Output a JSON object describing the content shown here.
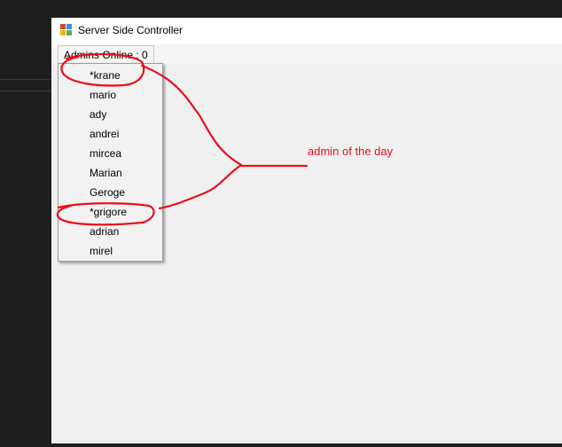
{
  "window": {
    "title": "Server Side Controller",
    "icon": "windows-forms-app-icon"
  },
  "menubar": {
    "admins_menu_label": "Admins Online : 0"
  },
  "dropdown": {
    "items": [
      {
        "label": "*krane"
      },
      {
        "label": "mario"
      },
      {
        "label": "ady"
      },
      {
        "label": "andrei"
      },
      {
        "label": "mircea"
      },
      {
        "label": "Marian"
      },
      {
        "label": "Geroge"
      },
      {
        "label": "*grigore"
      },
      {
        "label": "adrian"
      },
      {
        "label": "mirel"
      }
    ]
  },
  "annotation": {
    "text": "admin of the day",
    "color": "#e8101c"
  },
  "colors": {
    "desktop_bg": "#1e1e1e",
    "window_bg": "#f0f0f0",
    "titlebar_bg": "#ffffff"
  }
}
